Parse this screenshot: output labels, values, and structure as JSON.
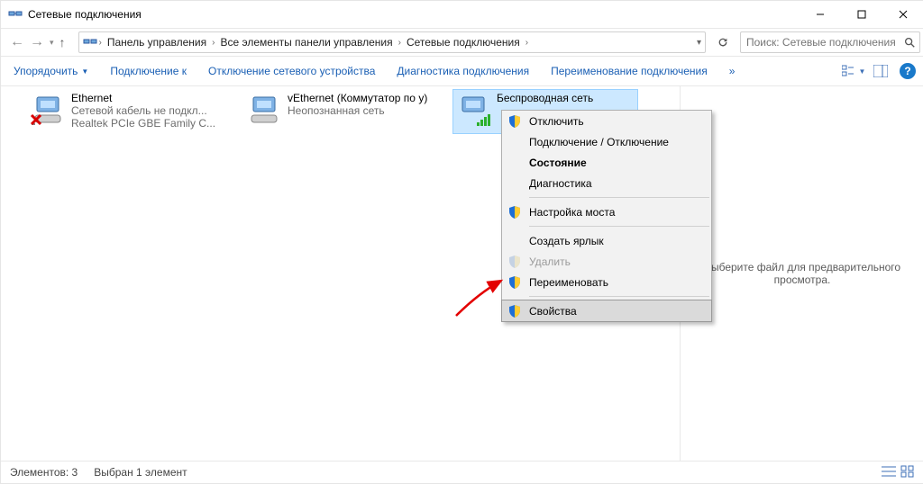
{
  "title": "Сетевые подключения",
  "breadcrumb": {
    "seg1": "Панель управления",
    "seg2": "Все элементы панели управления",
    "seg3": "Сетевые подключения"
  },
  "search": {
    "placeholder": "Поиск: Сетевые подключения"
  },
  "cmd": {
    "organize": "Упорядочить",
    "connect_to": "Подключение к",
    "disable_device": "Отключение сетевого устройства",
    "diagnose": "Диагностика подключения",
    "rename": "Переименование подключения",
    "more": "»"
  },
  "items": [
    {
      "name": "Ethernet",
      "sub1": "Сетевой кабель не подкл...",
      "sub2": "Realtek PCIe GBE Family C..."
    },
    {
      "name": "vEthernet (Коммутатор по у)",
      "sub1": "Неопознанная сеть",
      "sub2": ""
    },
    {
      "name": "Беспроводная сеть",
      "sub1": "",
      "sub2": ""
    }
  ],
  "ctx": {
    "disable": "Отключить",
    "connect_disconnect": "Подключение / Отключение",
    "status": "Состояние",
    "diagnose": "Диагностика",
    "bridge": "Настройка моста",
    "shortcut": "Создать ярлык",
    "delete": "Удалить",
    "rename": "Переименовать",
    "properties": "Свойства"
  },
  "preview": {
    "msg": "Выберите файл для предварительного просмотра."
  },
  "status": {
    "count": "Элементов: 3",
    "selected": "Выбран 1 элемент"
  }
}
